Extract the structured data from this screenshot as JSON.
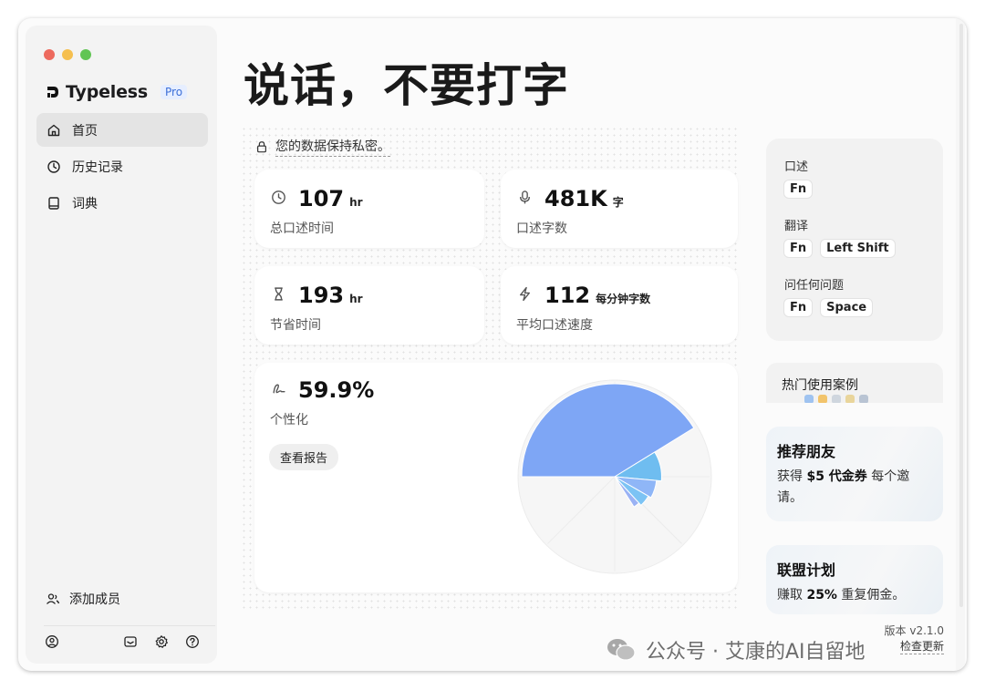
{
  "window": {
    "brand_name": "Typeless",
    "plan_badge": "Pro"
  },
  "sidebar": {
    "items": [
      {
        "label": "首页",
        "icon": "home-icon",
        "active": true
      },
      {
        "label": "历史记录",
        "icon": "history-icon",
        "active": false
      },
      {
        "label": "词典",
        "icon": "book-icon",
        "active": false
      }
    ],
    "add_member": "添加成员",
    "bottom_icons": [
      "account-icon",
      "mail-icon",
      "settings-icon",
      "help-icon"
    ]
  },
  "main": {
    "title": "说话，不要打字",
    "privacy_text": "您的数据保持私密。",
    "stats": [
      {
        "value": "107",
        "unit": "hr",
        "label": "总口述时间",
        "icon": "clock-icon"
      },
      {
        "value": "481K",
        "unit": "字",
        "label": "口述字数",
        "icon": "mic-icon"
      },
      {
        "value": "193",
        "unit": "hr",
        "label": "节省时间",
        "icon": "hourglass-icon"
      },
      {
        "value": "112",
        "unit": "每分钟字数",
        "label": "平均口述速度",
        "icon": "bolt-icon"
      }
    ],
    "personalization": {
      "value": "59.9%",
      "label": "个性化",
      "button": "查看报告",
      "icon": "signature-icon"
    }
  },
  "chart_data": {
    "type": "pie",
    "title": "",
    "slices": [
      {
        "value": 59.9,
        "color": "#7ea6f5"
      },
      {
        "value": 14,
        "color": "#6fbdf0"
      },
      {
        "value": 9,
        "color": "#8fb6f7"
      },
      {
        "value": 6,
        "color": "#7cc3f4"
      },
      {
        "value": 3,
        "color": "#9ab2f4"
      }
    ]
  },
  "shortcuts": {
    "items": [
      {
        "label": "口述",
        "keys": [
          "Fn"
        ]
      },
      {
        "label": "翻译",
        "keys": [
          "Fn",
          "Left Shift"
        ]
      },
      {
        "label": "问任何问题",
        "keys": [
          "Fn",
          "Space"
        ]
      }
    ]
  },
  "hot_cases": {
    "title": "热门使用案例"
  },
  "referral": {
    "title": "推荐朋友",
    "text_prefix": "获得 ",
    "text_bold": "$5 代金券",
    "text_suffix": " 每个邀请。"
  },
  "affiliate": {
    "title": "联盟计划",
    "text_prefix": "赚取 ",
    "text_bold": "25%",
    "text_suffix": " 重复佣金。"
  },
  "footer": {
    "version": "版本 v2.1.0",
    "check_update": "检查更新"
  },
  "watermark": {
    "text": "公众号 · 艾康的AI自留地"
  },
  "colors": {
    "accent": "#3c6fd8",
    "pie_main": "#7ea6f5"
  }
}
